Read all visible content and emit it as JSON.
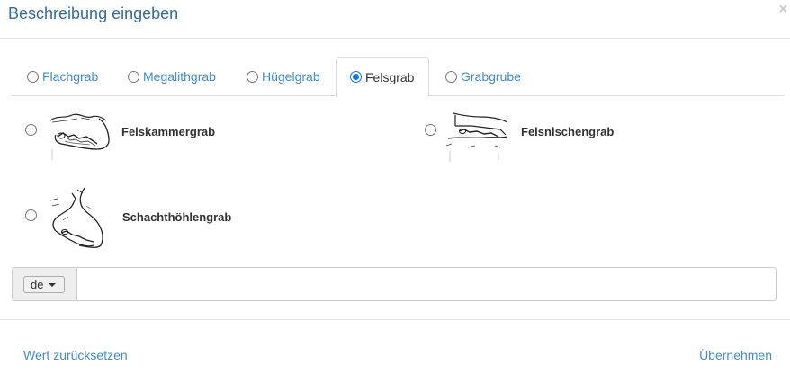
{
  "dialog": {
    "title": "Beschreibung eingeben",
    "close_glyph": "×"
  },
  "tabs": [
    {
      "label": "Flachgrab",
      "selected": false
    },
    {
      "label": "Megalithgrab",
      "selected": false
    },
    {
      "label": "Hügelgrab",
      "selected": false
    },
    {
      "label": "Felsgrab",
      "selected": true
    },
    {
      "label": "Grabgrube",
      "selected": false
    }
  ],
  "options": [
    {
      "label": "Felskammergrab",
      "icon": "felskammergrab-image",
      "selected": false
    },
    {
      "label": "Felsnischengrab",
      "icon": "felsnischengrab-image",
      "selected": false
    },
    {
      "label": "Schachthöhlengrab",
      "icon": "schachthoehlengrab-image",
      "selected": false
    }
  ],
  "language": {
    "selected": "de"
  },
  "text_field": {
    "value": "",
    "placeholder": ""
  },
  "footer": {
    "reset_label": "Wert zurücksetzen",
    "apply_label": "Übernehmen"
  },
  "colors": {
    "accent": "#3a8fd6",
    "title": "#2e6da4",
    "radio_checked": "#0075ff"
  }
}
